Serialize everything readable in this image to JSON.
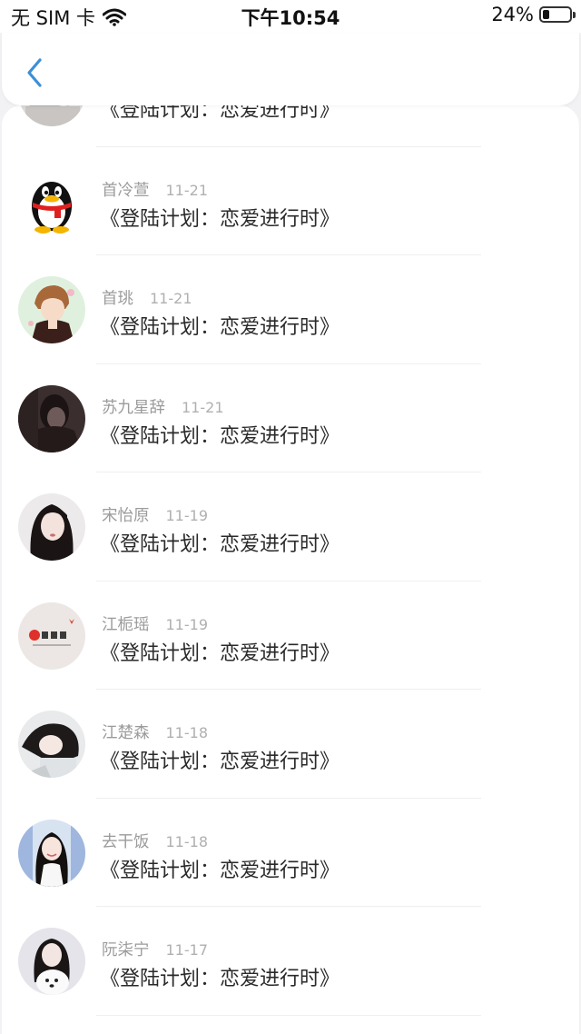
{
  "status_bar": {
    "carrier": "无 SIM 卡",
    "time": "下午10:54",
    "battery_text": "24%",
    "battery_level": 0.24
  },
  "nav": {
    "back_icon": "chevron-left-icon",
    "accent_color": "#3b8fd8"
  },
  "comments": [
    {
      "name": "",
      "date": "",
      "work": "《登陆计划：恋爱进行时》",
      "avatar": "photo-girl"
    },
    {
      "name": "首冷萱",
      "date": "11-21",
      "work": "《登陆计划：恋爱进行时》",
      "avatar": "qq-penguin"
    },
    {
      "name": "首珧",
      "date": "11-21",
      "work": "《登陆计划：恋爱进行时》",
      "avatar": "anime-boy"
    },
    {
      "name": "苏九星辞",
      "date": "11-21",
      "work": "《登陆计划：恋爱进行时》",
      "avatar": "dark-girl"
    },
    {
      "name": "宋怡原",
      "date": "11-19",
      "work": "《登陆计划：恋爱进行时》",
      "avatar": "portrait-girl"
    },
    {
      "name": "江栀瑶",
      "date": "11-19",
      "work": "《登陆计划：恋爱进行时》",
      "avatar": "text-logo"
    },
    {
      "name": "江楚森",
      "date": "11-18",
      "work": "《登陆计划：恋爱进行时》",
      "avatar": "sleeping-girl"
    },
    {
      "name": "去干饭",
      "date": "11-18",
      "work": "《登陆计划：恋爱进行时》",
      "avatar": "smiling-girl"
    },
    {
      "name": "阮柒宁",
      "date": "11-17",
      "work": "《登陆计划：恋爱进行时》",
      "avatar": "girl-with-dog"
    }
  ]
}
